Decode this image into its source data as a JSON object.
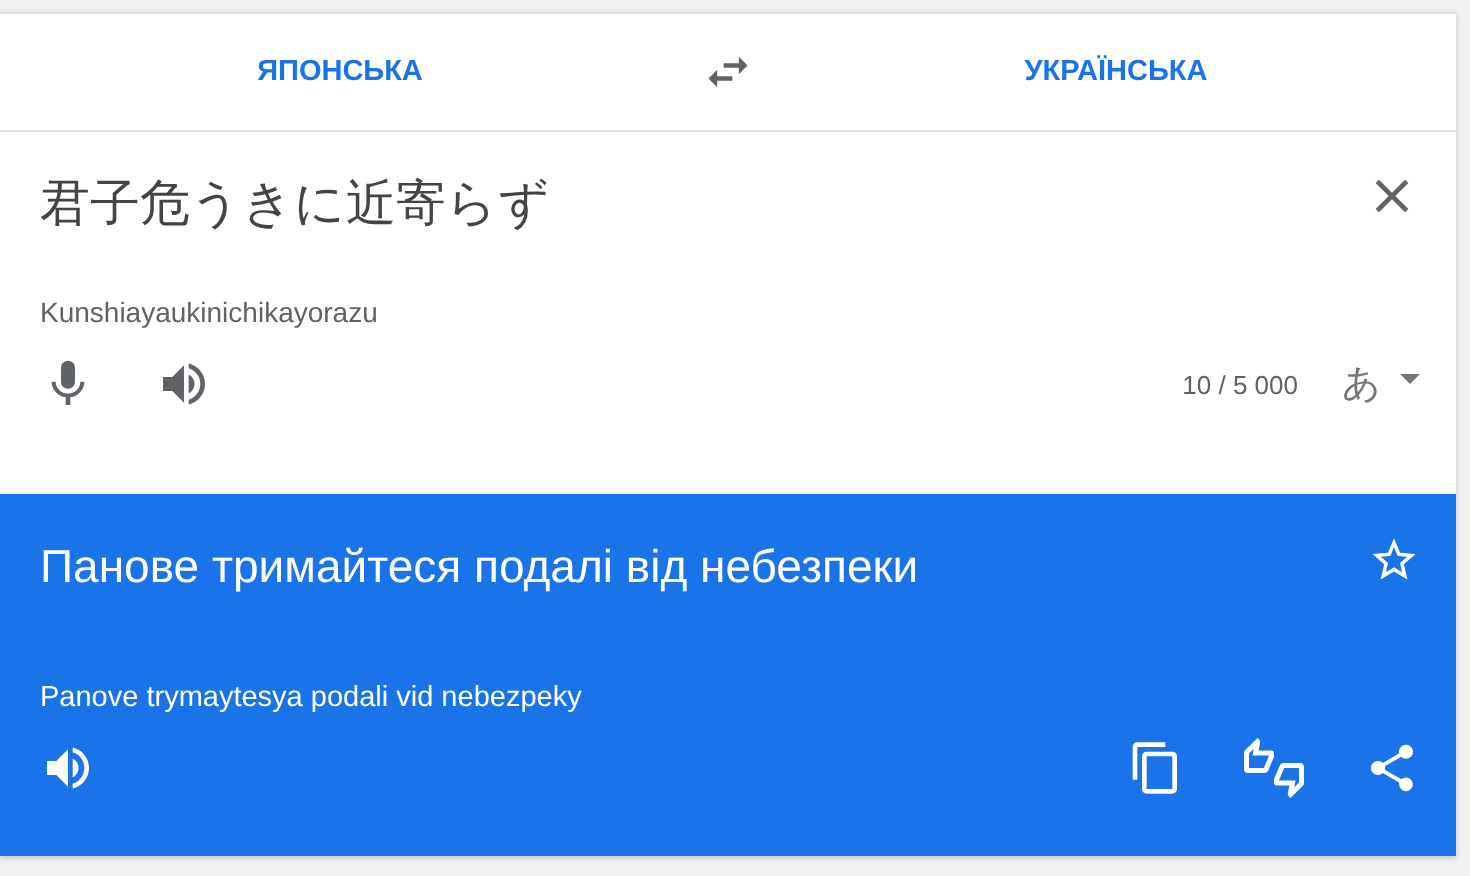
{
  "languages": {
    "source": "ЯПОНСЬКА",
    "target": "УКРАЇНСЬКА"
  },
  "input": {
    "text": "君子危うきに近寄らず",
    "transliteration": "Kunshiayaukinichikayorazu",
    "char_count": "10 / 5 000",
    "input_method": "あ"
  },
  "output": {
    "text": "Панове тримайтеся подалі від небезпеки",
    "transliteration": "Panove trymaytesya podali vid nebezpeky",
    "starred": false
  }
}
